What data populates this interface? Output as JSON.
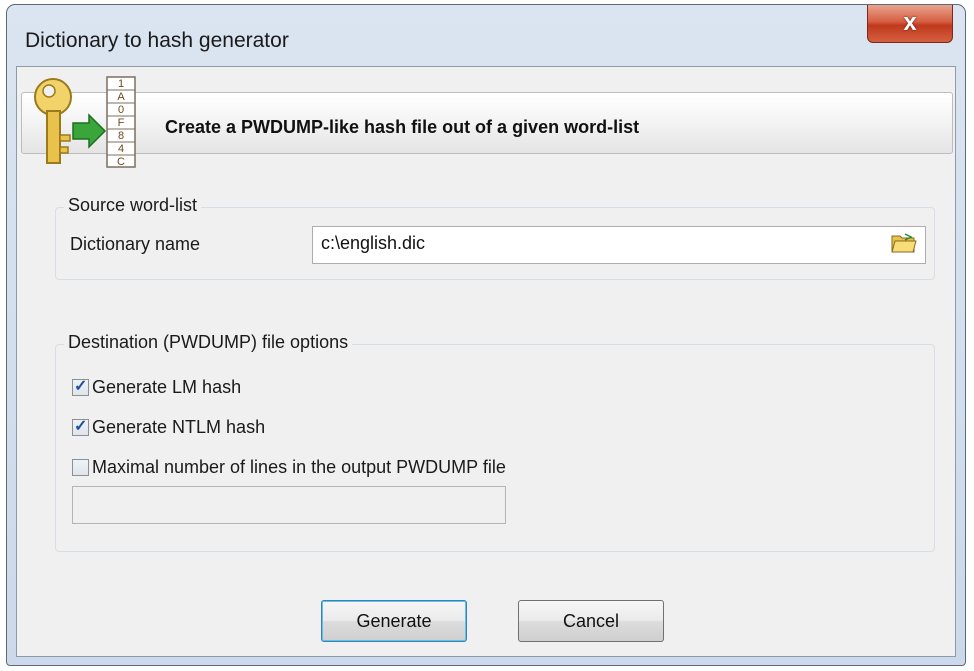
{
  "window": {
    "title": "Dictionary to hash generator",
    "close_glyph": "x"
  },
  "banner": {
    "text": "Create a PWDUMP-like hash file out of a given word-list",
    "icon": "key-with-hash-list-icon",
    "hash_chars": [
      "1",
      "A",
      "0",
      "F",
      "8",
      "4",
      "C"
    ]
  },
  "source": {
    "group_title": "Source word-list",
    "dictionary_label": "Dictionary name",
    "dictionary_value": "c:\\english.dic",
    "browse_icon": "folder-open-icon"
  },
  "destination": {
    "group_title": "Destination (PWDUMP) file options",
    "options": [
      {
        "label": "Generate LM hash",
        "checked": true
      },
      {
        "label": "Generate NTLM hash",
        "checked": true
      },
      {
        "label": "Maximal number of lines in the output PWDUMP file",
        "checked": false
      }
    ],
    "max_lines_value": ""
  },
  "buttons": {
    "generate": "Generate",
    "cancel": "Cancel"
  },
  "colors": {
    "close_button": "#c0391d",
    "checkmark": "#1f4e9c",
    "key": "#e8c24a",
    "arrow": "#3aa53a"
  }
}
